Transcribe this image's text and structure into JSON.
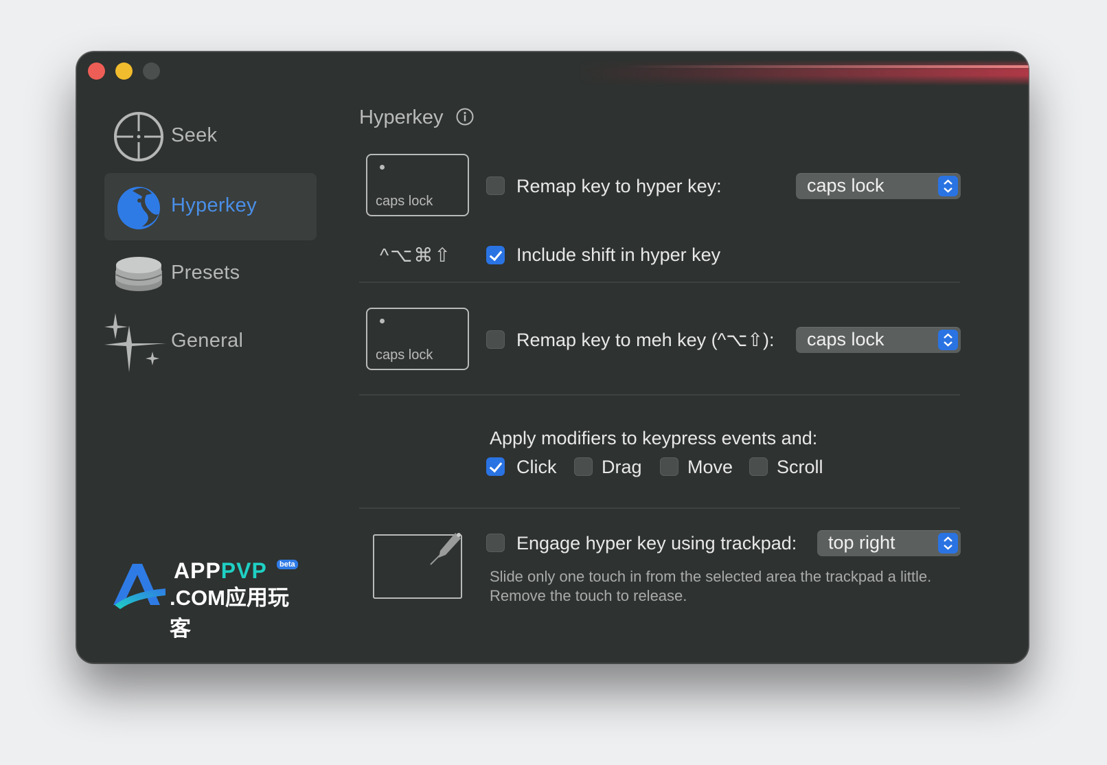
{
  "sidebar": {
    "items": [
      {
        "label": "Seek",
        "icon": "crosshair-icon"
      },
      {
        "label": "Hyperkey",
        "icon": "hyperkey-icon",
        "active": true
      },
      {
        "label": "Presets",
        "icon": "stack-icon"
      },
      {
        "label": "General",
        "icon": "sparkles-icon"
      }
    ],
    "logo": {
      "line1_a": "APP",
      "line1_b": "PVP",
      "line2": ".COM应用玩客",
      "badge": "beta"
    }
  },
  "main": {
    "title": "Hyperkey",
    "hyper_key": {
      "keycap_label": "caps lock",
      "remap_label": "Remap key to hyper key:",
      "remap_checked": false,
      "remap_value": "caps lock",
      "modifier_symbols": "^⌥⌘⇧",
      "include_shift_label": "Include shift in hyper key",
      "include_shift_checked": true
    },
    "meh_key": {
      "keycap_label": "caps lock",
      "remap_label": "Remap key to meh key (^⌥⇧):",
      "remap_checked": false,
      "remap_value": "caps lock"
    },
    "modifiers": {
      "heading": "Apply modifiers to keypress events and:",
      "options": [
        {
          "label": "Click",
          "checked": true
        },
        {
          "label": "Drag",
          "checked": false
        },
        {
          "label": "Move",
          "checked": false
        },
        {
          "label": "Scroll",
          "checked": false
        }
      ]
    },
    "trackpad": {
      "label": "Engage hyper key using trackpad:",
      "checked": false,
      "value": "top right",
      "help_line1": "Slide only one touch in from the selected area the trackpad a little.",
      "help_line2": "Remove the touch to release."
    }
  },
  "colors": {
    "accent": "#2a73e3",
    "active_text": "#4a8fe8",
    "window_bg": "#2e3230"
  }
}
